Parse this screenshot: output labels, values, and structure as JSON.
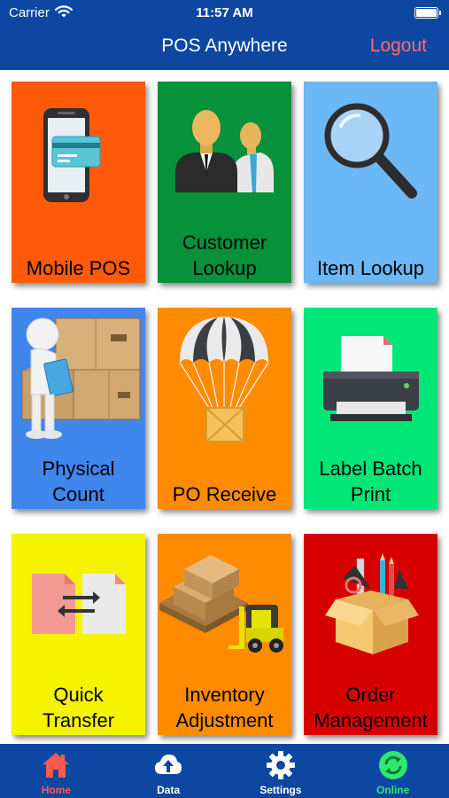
{
  "status_bar": {
    "carrier": "Carrier",
    "time": "11:57 AM"
  },
  "header": {
    "title": "POS Anywhere",
    "logout_label": "Logout"
  },
  "tiles": [
    {
      "label": "Mobile POS",
      "color": "#ff5a0a",
      "icon": "mobile-payment-icon"
    },
    {
      "label": "Customer Lookup",
      "color": "#06913a",
      "icon": "customers-icon"
    },
    {
      "label": "Item Lookup",
      "color": "#6cb7f5",
      "icon": "magnifier-icon"
    },
    {
      "label": "Physical Count",
      "color": "#3f86ed",
      "icon": "warehouse-clipboard-icon"
    },
    {
      "label": "PO Receive",
      "color": "#ff8c00",
      "icon": "parachute-crate-icon"
    },
    {
      "label": "Label Batch Print",
      "color": "#00e677",
      "icon": "printer-icon"
    },
    {
      "label": "Quick Transfer",
      "color": "#f5f300",
      "icon": "file-transfer-icon"
    },
    {
      "label": "Inventory Adjustment",
      "color": "#ff8c00",
      "icon": "forklift-boxes-icon"
    },
    {
      "label": "Order Management",
      "color": "#d70000",
      "icon": "supplies-box-icon"
    }
  ],
  "tabs": [
    {
      "label": "Home",
      "icon": "home-icon",
      "color": "#ff5a4f",
      "active": true
    },
    {
      "label": "Data",
      "icon": "cloud-upload-icon",
      "color": "#ffffff"
    },
    {
      "label": "Settings",
      "icon": "gear-icon",
      "color": "#ffffff"
    },
    {
      "label": "Online",
      "icon": "sync-icon",
      "color": "#2ee86f"
    }
  ]
}
